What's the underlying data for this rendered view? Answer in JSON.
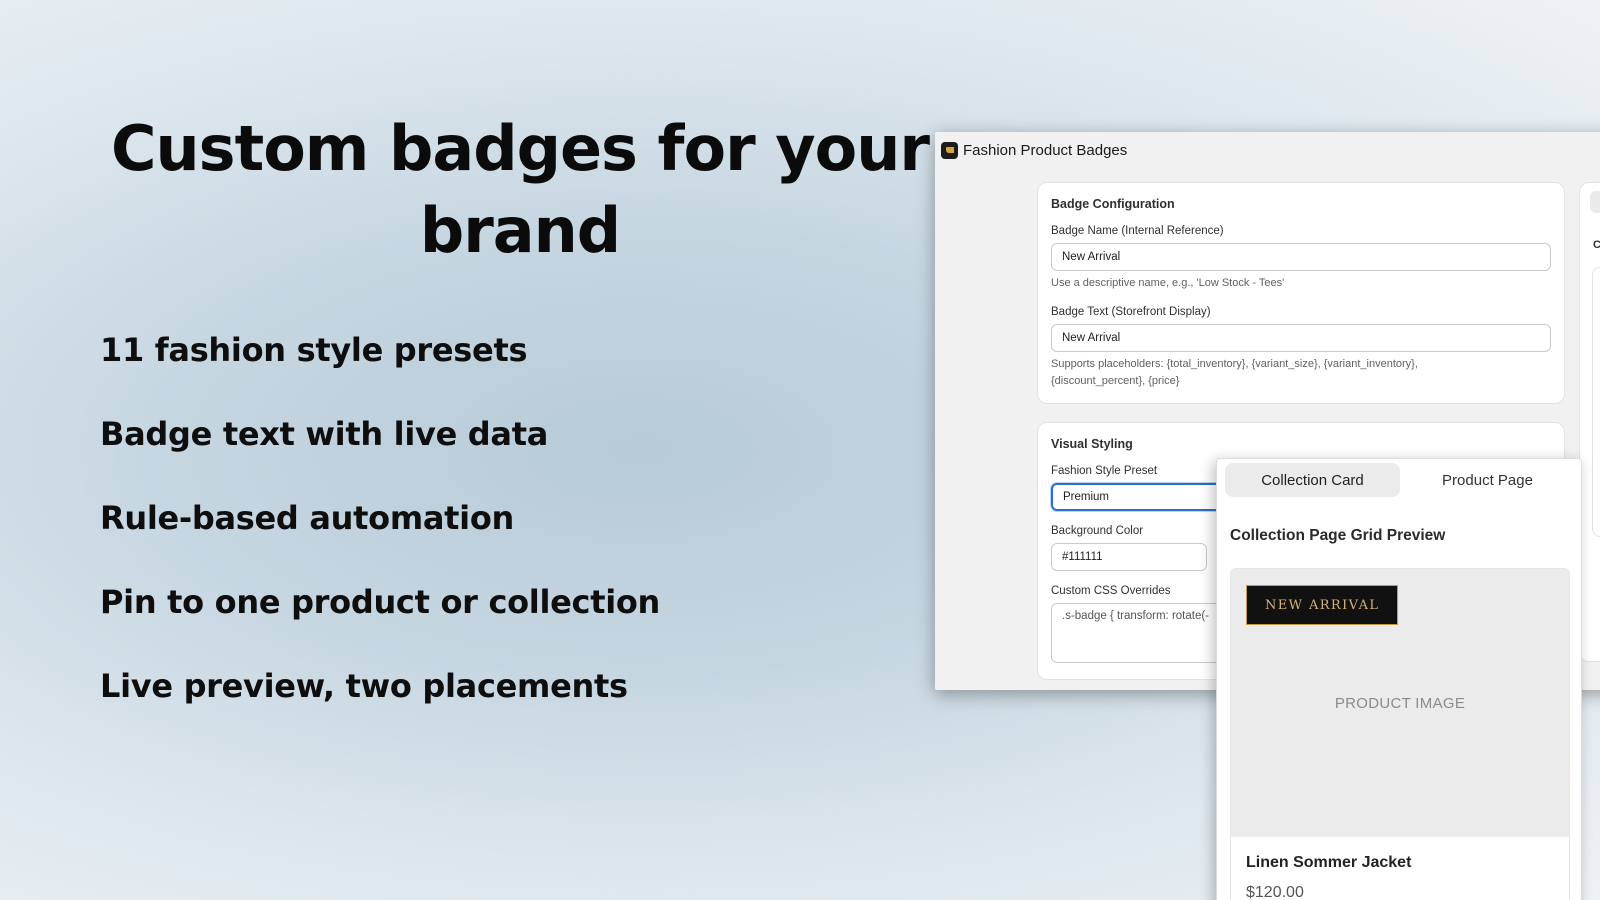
{
  "hero": {
    "headline": "Custom badges for your brand",
    "features": [
      "11 fashion style presets",
      "Badge text with live data",
      "Rule-based automation",
      "Pin to one product or collection",
      "Live preview, two placements"
    ]
  },
  "app": {
    "title": "Fashion Product Badges",
    "logo_icon": "badge-logo-icon",
    "config_card": {
      "title": "Badge Configuration",
      "name_label": "Badge Name (Internal Reference)",
      "name_value": "New Arrival",
      "name_help": "Use a descriptive name, e.g., 'Low Stock - Tees'",
      "text_label": "Badge Text (Storefront Display)",
      "text_value": "New Arrival",
      "text_help": "Supports placeholders: {total_inventory}, {variant_size}, {variant_inventory}, {discount_percent}, {price}"
    },
    "visual_card": {
      "title": "Visual Styling",
      "preset_label": "Fashion Style Preset",
      "preset_value": "Premium",
      "bg_label": "Background Color",
      "bg_value": "#111111",
      "css_label": "Custom CSS Overrides",
      "css_value": ".s-badge { transform: rotate(-"
    },
    "side_card": {
      "label": "Co"
    }
  },
  "preview": {
    "tabs": [
      "Collection Card",
      "Product Page"
    ],
    "active_tab": 0,
    "title": "Collection Page Grid Preview",
    "badge_text": "NEW ARRIVAL",
    "image_placeholder": "PRODUCT IMAGE",
    "product_name": "Linen Sommer Jacket",
    "product_price": "$120.00"
  },
  "colors": {
    "badge_background": "#111111",
    "badge_border": "#c79b3d",
    "badge_text": "#d6b274",
    "focus_ring": "#2c6ecb",
    "logo_accent": "#d8a53a"
  }
}
